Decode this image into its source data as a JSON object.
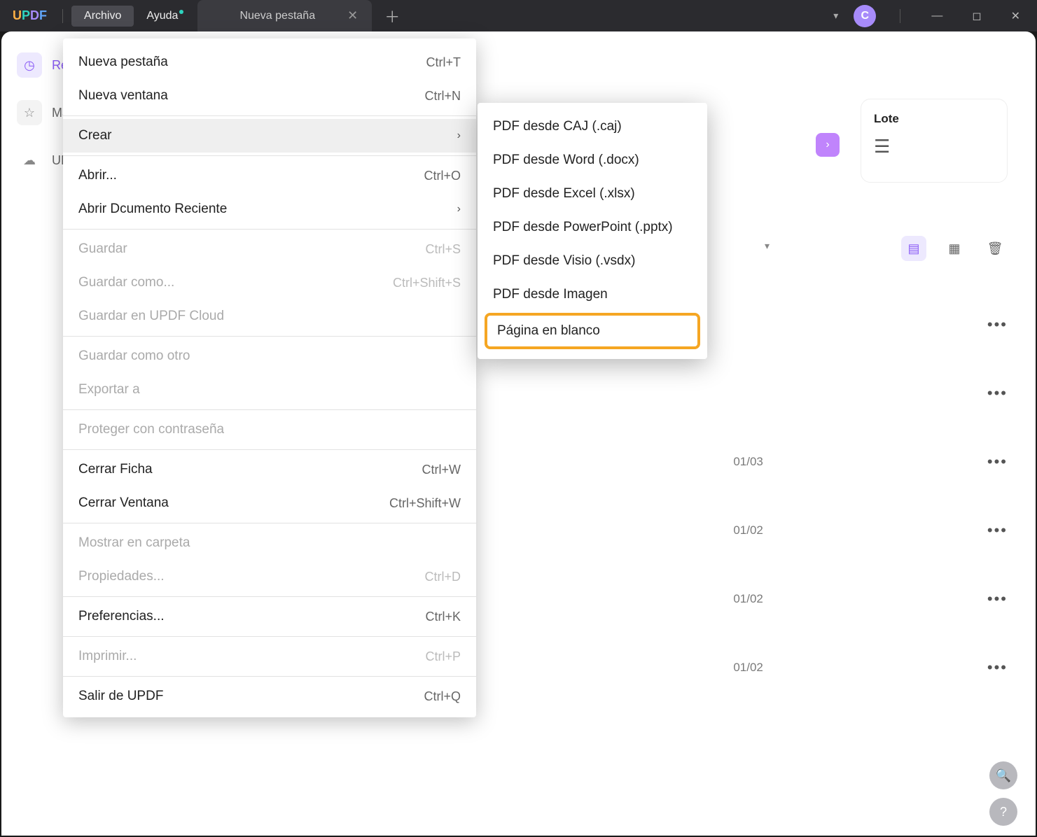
{
  "titlebar": {
    "logo": {
      "u": "U",
      "p": "P",
      "d": "D",
      "f": "F"
    },
    "menu_file": "Archivo",
    "menu_help": "Ayuda",
    "tab_label": "Nueva pestaña",
    "avatar_letter": "C"
  },
  "sidebar": {
    "items": [
      {
        "label": "Recie"
      },
      {
        "label": "Marc"
      },
      {
        "label": "UPD"
      }
    ]
  },
  "cards": {
    "lote_title": "Lote"
  },
  "rows": [
    {
      "date": ""
    },
    {
      "date": ""
    },
    {
      "date": "01/03"
    },
    {
      "date": "01/02"
    },
    {
      "date": "01/02"
    },
    {
      "date": "01/02"
    }
  ],
  "menu": {
    "items": [
      {
        "label": "Nueva pestaña",
        "shortcut": "Ctrl+T"
      },
      {
        "label": "Nueva ventana",
        "shortcut": "Ctrl+N"
      },
      {
        "label": "Crear",
        "submenu": true
      },
      {
        "label": "Abrir...",
        "shortcut": "Ctrl+O"
      },
      {
        "label": "Abrir Dcumento Reciente",
        "submenu": true
      },
      {
        "label": "Guardar",
        "shortcut": "Ctrl+S",
        "disabled": true
      },
      {
        "label": "Guardar como...",
        "shortcut": "Ctrl+Shift+S",
        "disabled": true
      },
      {
        "label": "Guardar en UPDF Cloud",
        "disabled": true
      },
      {
        "label": "Guardar como otro",
        "disabled": true
      },
      {
        "label": "Exportar a",
        "disabled": true
      },
      {
        "label": "Proteger con contraseña",
        "disabled": true
      },
      {
        "label": "Cerrar Ficha",
        "shortcut": "Ctrl+W"
      },
      {
        "label": "Cerrar Ventana",
        "shortcut": "Ctrl+Shift+W"
      },
      {
        "label": "Mostrar en carpeta",
        "disabled": true
      },
      {
        "label": "Propiedades...",
        "shortcut": "Ctrl+D",
        "disabled": true
      },
      {
        "label": "Preferencias...",
        "shortcut": "Ctrl+K"
      },
      {
        "label": "Imprimir...",
        "shortcut": "Ctrl+P",
        "disabled": true
      },
      {
        "label": "Salir de UPDF",
        "shortcut": "Ctrl+Q"
      }
    ]
  },
  "submenu": {
    "items": [
      {
        "label": "PDF desde CAJ (.caj)"
      },
      {
        "label": "PDF desde Word (.docx)"
      },
      {
        "label": "PDF desde Excel (.xlsx)"
      },
      {
        "label": "PDF desde PowerPoint (.pptx)"
      },
      {
        "label": "PDF desde Visio (.vsdx)"
      },
      {
        "label": "PDF desde Imagen"
      },
      {
        "label": "Página en blanco",
        "highlight": true
      }
    ]
  }
}
